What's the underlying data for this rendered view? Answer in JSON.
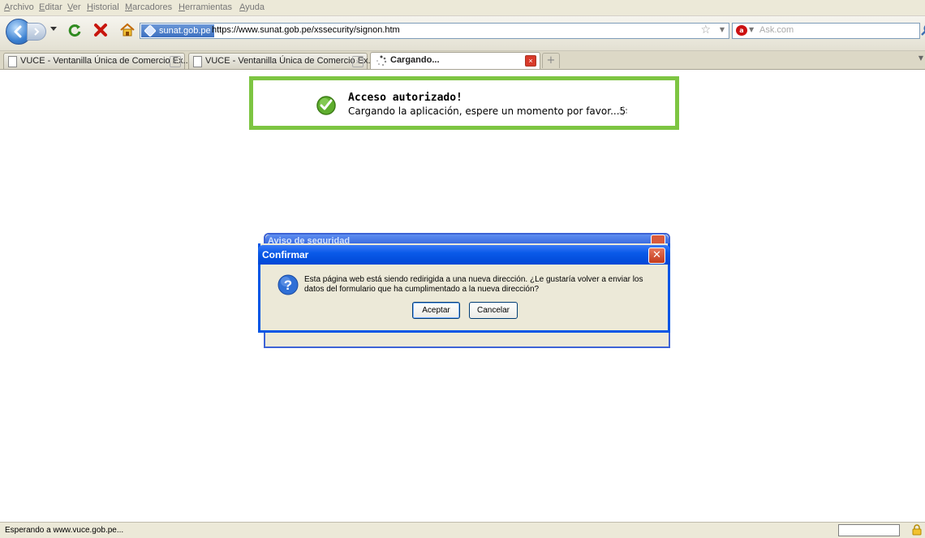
{
  "menu": [
    "Archivo",
    "Editar",
    "Ver",
    "Historial",
    "Marcadores",
    "Herramientas",
    "Ayuda"
  ],
  "navbar": {
    "site_identity": "sunat.gob.pe",
    "url": "https://www.sunat.gob.pe/xssecurity/signon.htm",
    "search_placeholder": "Ask.com"
  },
  "tabs": [
    {
      "label": "VUCE - Ventanilla Única de Comercio Ex...",
      "active": false
    },
    {
      "label": "VUCE - Ventanilla Única de Comercio Ex...",
      "active": false
    },
    {
      "label": "Cargando...",
      "active": true
    }
  ],
  "content": {
    "access_title": "Acceso autorizado!",
    "access_message": "Cargando la aplicación, espere un momento por favor...5"
  },
  "dialog_back": {
    "title": "Aviso de seguridad"
  },
  "dialog": {
    "title": "Confirmar",
    "message": "Esta página web está siendo redirigida a una nueva dirección. ¿Le gustaría volver a enviar los datos del formulario que ha cumplimentado a la nueva dirección?",
    "accept_label": "Aceptar",
    "cancel_label": "Cancelar"
  },
  "status": {
    "text": "Esperando a www.vuce.gob.pe..."
  },
  "colors": {
    "success_border": "#7dc542",
    "dialog_title": "#0a5ae8",
    "dialog_body": "#ece9d8"
  }
}
